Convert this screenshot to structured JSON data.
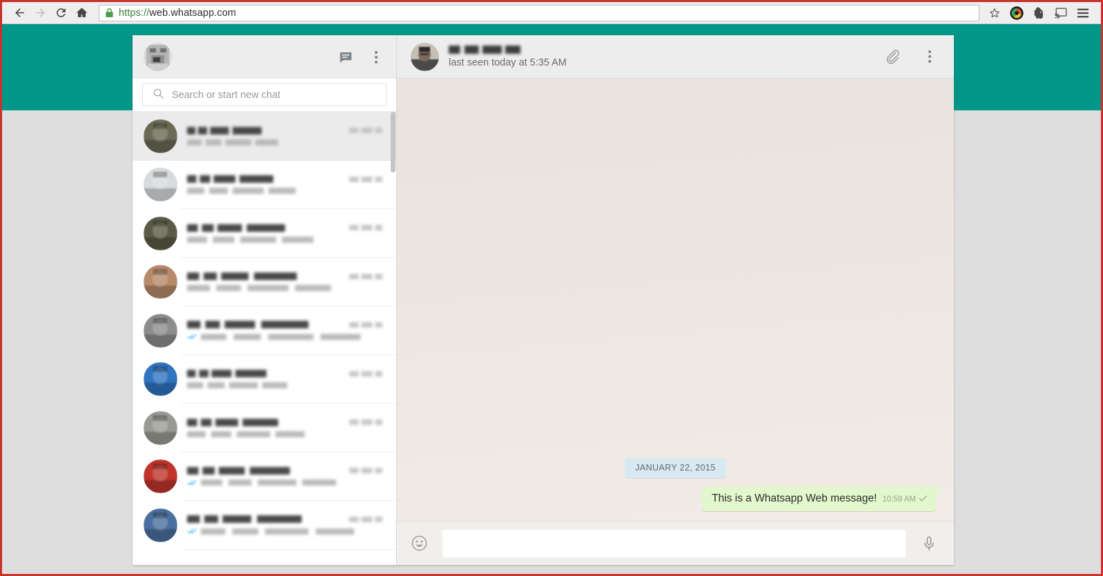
{
  "browser": {
    "back_label": "Back",
    "forward_label": "Forward",
    "reload_label": "Reload",
    "home_label": "Home",
    "url_scheme": "https://",
    "url_host": "web.whatsapp.com",
    "lock_icon": "lock-icon",
    "bookmark_icon": "star-icon",
    "extension_1_icon": "colorful-circle-extension-icon",
    "extension_2_icon": "evernote-elephant-icon",
    "cast_icon": "cast-icon",
    "menu_icon": "hamburger-menu-icon"
  },
  "theme": {
    "teal": "#009688",
    "page_background": "#dedede",
    "frame_border": "#c8322a",
    "panel_header": "#ededed",
    "bubble_out": "#e2f7cb",
    "date_pill": "#d9e9f2",
    "selected_chat": "#ebebeb"
  },
  "sidebar": {
    "profile_avatar": "profile-avatar",
    "new_chat_icon": "new-chat-icon",
    "menu_icon": "menu-dots-icon",
    "search": {
      "placeholder": "Search or start new chat",
      "value": "",
      "icon": "search-icon"
    },
    "chats": [
      {
        "name_redacted": true,
        "preview_redacted": true,
        "time_redacted": true,
        "selected": true,
        "has_check": false,
        "avatar_tone": "#6b6a55"
      },
      {
        "name_redacted": true,
        "preview_redacted": true,
        "time_redacted": true,
        "selected": false,
        "has_check": false,
        "avatar_tone": "#d8dadb"
      },
      {
        "name_redacted": true,
        "preview_redacted": true,
        "time_redacted": true,
        "selected": false,
        "has_check": false,
        "avatar_tone": "#5b5a46"
      },
      {
        "name_redacted": true,
        "preview_redacted": true,
        "time_redacted": true,
        "selected": false,
        "has_check": false,
        "avatar_tone": "#b78a6a"
      },
      {
        "name_redacted": true,
        "preview_redacted": true,
        "time_redacted": true,
        "selected": false,
        "has_check": true,
        "avatar_tone": "#8d8d8d"
      },
      {
        "name_redacted": true,
        "preview_redacted": true,
        "time_redacted": true,
        "selected": false,
        "has_check": false,
        "avatar_tone": "#2f74c0"
      },
      {
        "name_redacted": true,
        "preview_redacted": true,
        "time_redacted": true,
        "selected": false,
        "has_check": false,
        "avatar_tone": "#9a9a93"
      },
      {
        "name_redacted": true,
        "preview_redacted": true,
        "time_redacted": true,
        "selected": false,
        "has_check": true,
        "avatar_tone": "#c0342c"
      },
      {
        "name_redacted": true,
        "preview_redacted": true,
        "time_redacted": true,
        "selected": false,
        "has_check": true,
        "avatar_tone": "#4a6f9e"
      }
    ]
  },
  "conversation": {
    "contact_name_redacted": true,
    "status": "last seen today at 5:35 AM",
    "attach_icon": "paperclip-icon",
    "menu_icon": "menu-dots-icon",
    "date_divider": "JANUARY 22, 2015",
    "messages": [
      {
        "direction": "outgoing",
        "text": "This is a Whatsapp Web message!",
        "time": "10:59 AM",
        "status_icon": "single-check-icon"
      }
    ],
    "composer": {
      "emoji_icon": "smiley-icon",
      "placeholder": "",
      "value": "",
      "mic_icon": "microphone-icon"
    }
  }
}
